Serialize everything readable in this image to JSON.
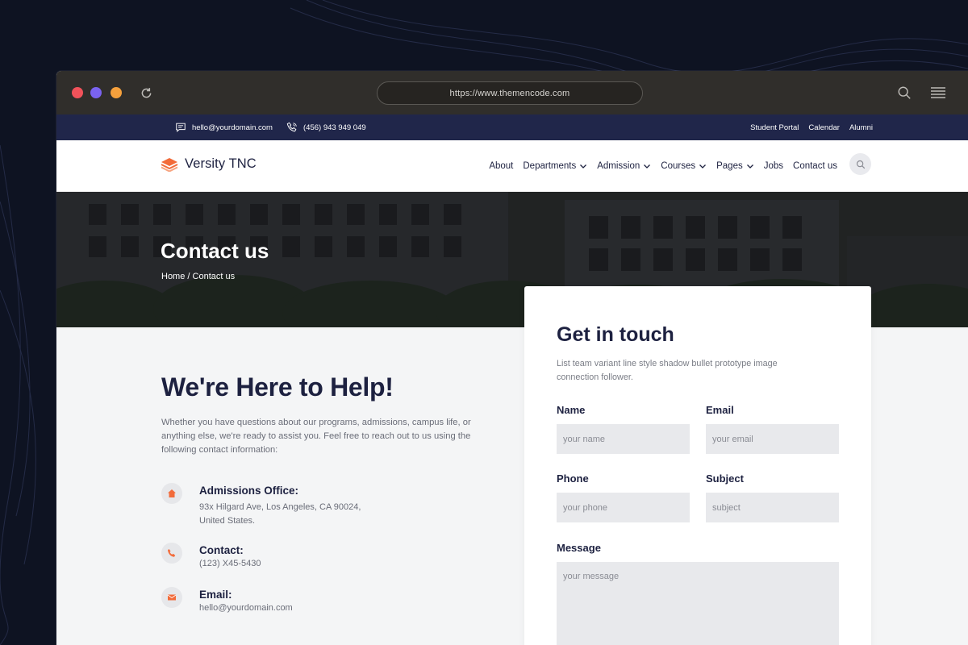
{
  "browser": {
    "url": "https://www.themencode.com"
  },
  "topbar": {
    "email": "hello@yourdomain.com",
    "phone": "(456) 943 949 049",
    "links": [
      "Student Portal",
      "Calendar",
      "Alumni"
    ]
  },
  "header": {
    "logo_text": "Versity TNC",
    "nav": [
      {
        "label": "About",
        "dropdown": false
      },
      {
        "label": "Departments",
        "dropdown": true
      },
      {
        "label": "Admission",
        "dropdown": true
      },
      {
        "label": "Courses",
        "dropdown": true
      },
      {
        "label": "Pages",
        "dropdown": true
      },
      {
        "label": "Jobs",
        "dropdown": false
      },
      {
        "label": "Contact us",
        "dropdown": false
      }
    ]
  },
  "hero": {
    "title": "Contact us",
    "breadcrumb": "Home / Contact us"
  },
  "help": {
    "title": "We're Here to Help!",
    "description": "Whether you have questions about our programs, admissions, campus life, or anything else, we're ready to assist you. Feel free to reach out to us using the following contact information:",
    "items": [
      {
        "icon": "home-icon",
        "title": "Admissions Office:",
        "value_line1": "93x Hilgard Ave, Los Angeles, CA 90024,",
        "value_line2": "United States."
      },
      {
        "icon": "phone-icon",
        "title": "Contact:",
        "value_line1": "(123) X45-5430",
        "value_line2": ""
      },
      {
        "icon": "mail-icon",
        "title": "Email:",
        "value_line1": "hello@yourdomain.com",
        "value_line2": ""
      }
    ]
  },
  "form": {
    "title": "Get in touch",
    "subtitle": "List team variant line style shadow bullet prototype image connection follower.",
    "name_label": "Name",
    "name_placeholder": "your name",
    "email_label": "Email",
    "email_placeholder": "your email",
    "phone_label": "Phone",
    "phone_placeholder": "your phone",
    "subject_label": "Subject",
    "subject_placeholder": "subject",
    "message_label": "Message",
    "message_placeholder": "your message"
  },
  "colors": {
    "accent": "#f26b3a",
    "navy": "#1d2140",
    "topbar": "#20264a"
  }
}
